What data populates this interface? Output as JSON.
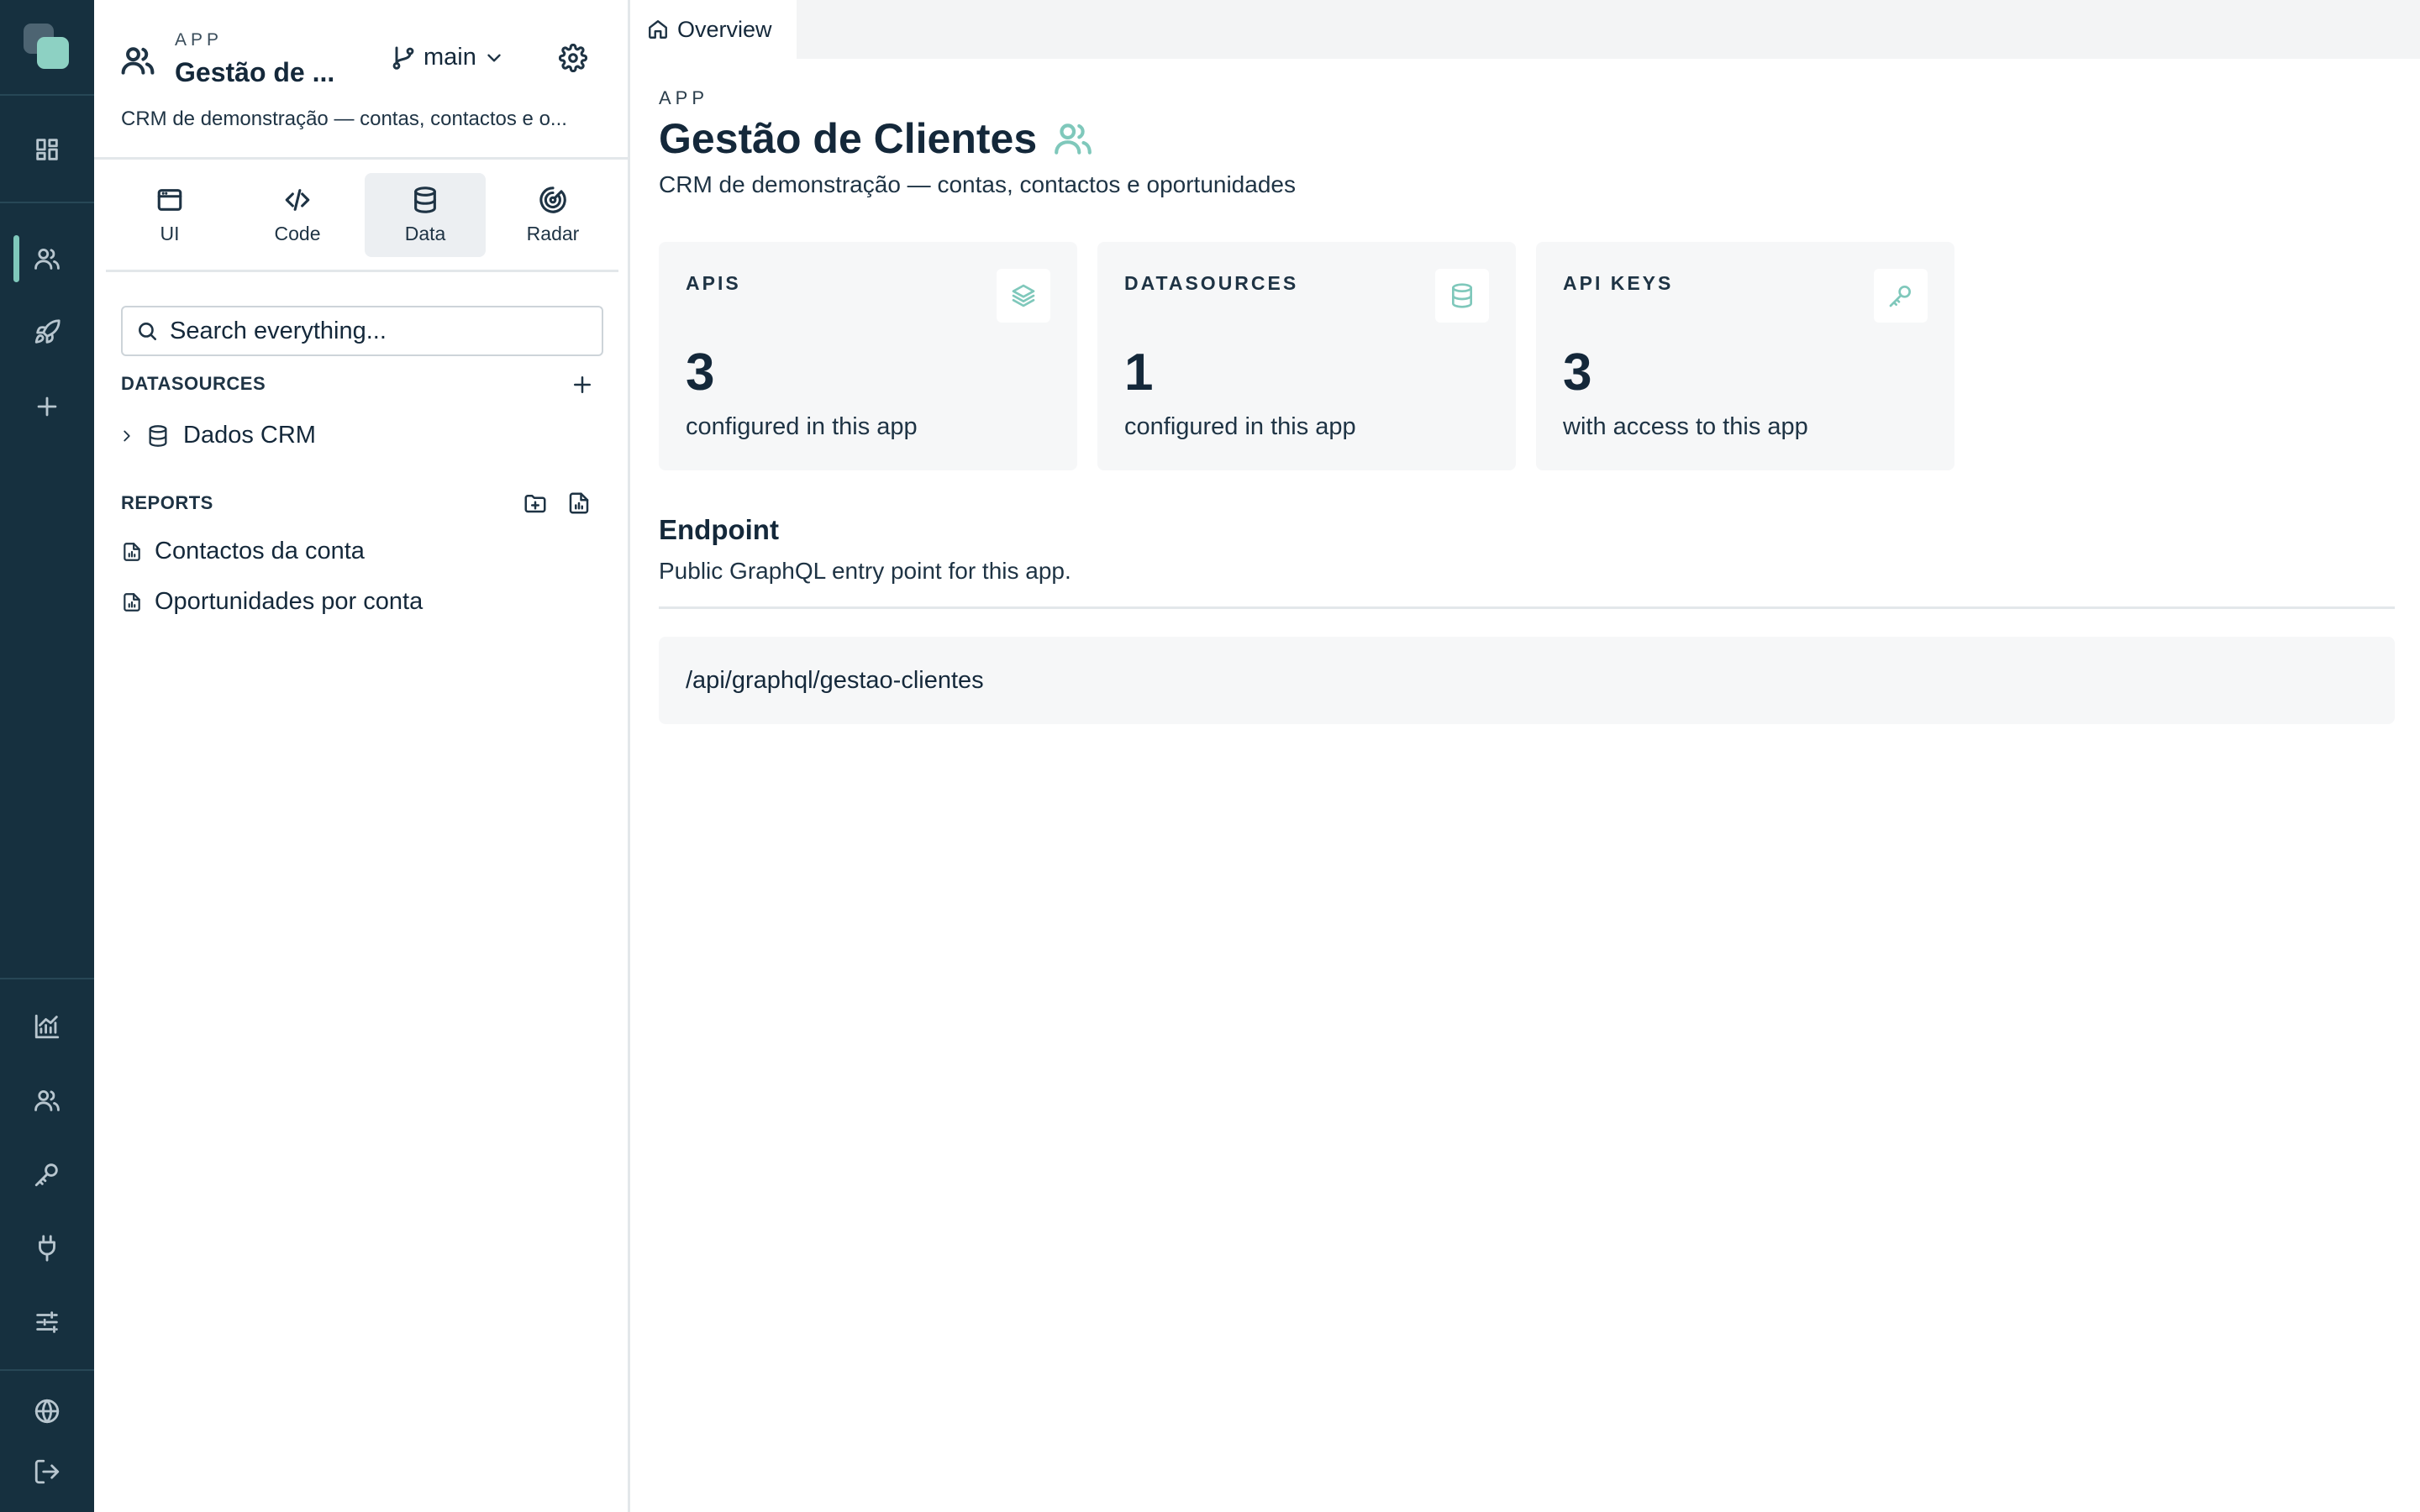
{
  "rail": {
    "top_items": [
      "dashboard-icon",
      "users-icon",
      "rocket-icon",
      "plus-icon"
    ],
    "bottom_items": [
      "chart-icon",
      "users-icon",
      "key-icon",
      "plug-icon",
      "sliders-icon",
      "globe-icon",
      "logout-icon"
    ]
  },
  "panel": {
    "kicker": "APP",
    "app_name": "Gestão de ...",
    "branch": "main",
    "description": "CRM de demonstração — contas, contactos e o...",
    "tabs": [
      {
        "label": "UI",
        "icon": "window-icon"
      },
      {
        "label": "Code",
        "icon": "code-icon"
      },
      {
        "label": "Data",
        "icon": "database-icon",
        "active": true
      },
      {
        "label": "Radar",
        "icon": "radar-icon"
      }
    ],
    "search_placeholder": "Search everything...",
    "datasources": {
      "title": "DATASOURCES",
      "items": [
        "Dados CRM"
      ]
    },
    "reports": {
      "title": "REPORTS",
      "items": [
        "Contactos da conta",
        "Oportunidades por conta"
      ]
    }
  },
  "main": {
    "tab": "Overview",
    "kicker": "APP",
    "title": "Gestão de Clientes",
    "description": "CRM de demonstração — contas, contactos e oportunidades",
    "cards": [
      {
        "title": "APIS",
        "value": "3",
        "subtitle": "configured in this app",
        "icon": "layers-icon"
      },
      {
        "title": "DATASOURCES",
        "value": "1",
        "subtitle": "configured in this app",
        "icon": "database-icon"
      },
      {
        "title": "API KEYS",
        "value": "3",
        "subtitle": "with access to this app",
        "icon": "key-icon"
      }
    ],
    "endpoint": {
      "title": "Endpoint",
      "description": "Public GraphQL entry point for this app.",
      "path": "/api/graphql/gestao-clientes"
    }
  },
  "colors": {
    "rail_bg": "#16303f",
    "accent": "#7fc8bb",
    "text": "#14283a",
    "card_bg": "#f6f7f8"
  }
}
